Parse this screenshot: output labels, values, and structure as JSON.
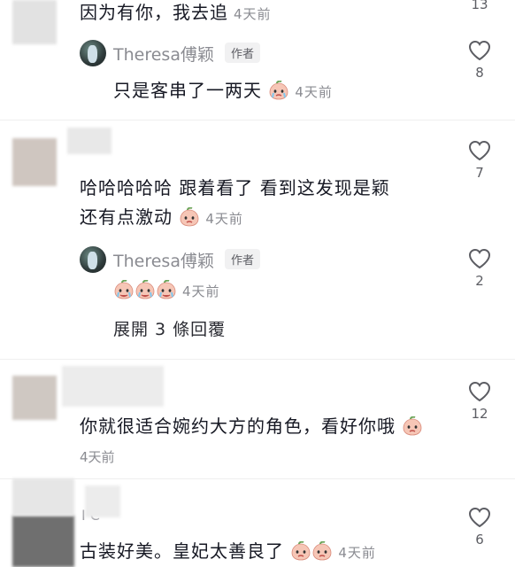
{
  "comments": [
    {
      "text": "因为有你，我去追",
      "time": "4天前",
      "likes": "13"
    },
    {
      "author": "Theresa傅颖",
      "badge": "作者",
      "text": "只是客串了一两天",
      "emoji": "peach",
      "time": "4天前",
      "likes": "8"
    },
    {
      "text_line1": "哈哈哈哈哈  跟着看了  看到这发现是颖",
      "text_line2": "还有点激动",
      "emoji": "peach",
      "time": "4天前",
      "likes": "7"
    },
    {
      "author": "Theresa傅颖",
      "badge": "作者",
      "emoji_count": 3,
      "time": "4天前",
      "likes": "2"
    },
    {
      "text": "你就很适合婉约大方的角色，看好你哦",
      "emoji": "peach",
      "time": "4天前",
      "likes": "12"
    },
    {
      "text": "古装好美。皇妃太善良了",
      "emoji_count": 2,
      "time": "4天前",
      "likes": "6"
    }
  ],
  "expand_replies": "展開 3 條回覆",
  "partial_username": "I  C",
  "icons": {
    "like": "heart-outline-icon",
    "emoji": "crying-peach-emoji"
  }
}
